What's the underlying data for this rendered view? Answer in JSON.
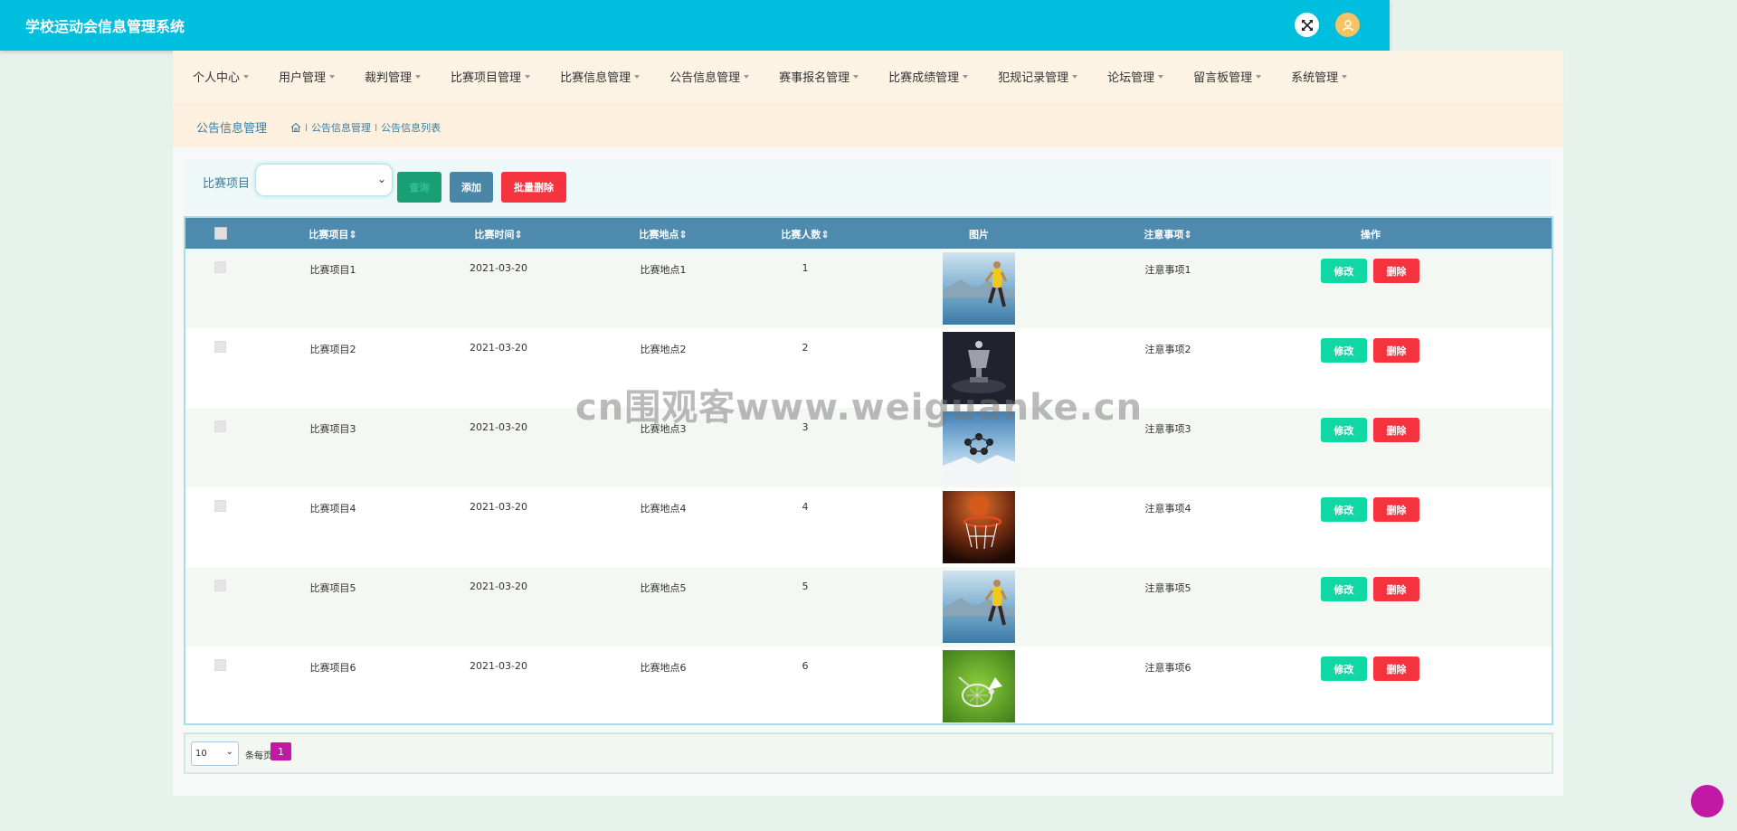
{
  "header": {
    "title": "学校运动会信息管理系统",
    "fullscreen_icon": "expand-icon",
    "user_icon": "user-avatar-icon"
  },
  "nav": {
    "items": [
      {
        "label": "个人中心"
      },
      {
        "label": "用户管理"
      },
      {
        "label": "裁判管理"
      },
      {
        "label": "比赛项目管理"
      },
      {
        "label": "比赛信息管理"
      },
      {
        "label": "公告信息管理"
      },
      {
        "label": "赛事报名管理"
      },
      {
        "label": "比赛成绩管理"
      },
      {
        "label": "犯规记录管理"
      },
      {
        "label": "论坛管理"
      },
      {
        "label": "留言板管理"
      },
      {
        "label": "系统管理"
      }
    ]
  },
  "breadcrumb": {
    "title": "公告信息管理",
    "home_icon": "home-icon",
    "sep": "l",
    "level1": "公告信息管理",
    "level2": "公告信息列表"
  },
  "filter": {
    "label": "比赛项目",
    "select_value": "",
    "search_label": "查询",
    "add_label": "添加",
    "batch_delete_label": "批量删除"
  },
  "table": {
    "columns": [
      "比赛项目",
      "比赛时间",
      "比赛地点",
      "比赛人数",
      "图片",
      "注意事项",
      "操作"
    ],
    "sort_mark": "⇕",
    "rows": [
      {
        "name": "比赛项目1",
        "time": "2021-03-20",
        "place": "比赛地点1",
        "count": "1",
        "note": "注意事项1",
        "image": "runner-photo"
      },
      {
        "name": "比赛项目2",
        "time": "2021-03-20",
        "place": "比赛地点2",
        "count": "2",
        "note": "注意事项2",
        "image": "trophy-photo"
      },
      {
        "name": "比赛项目3",
        "time": "2021-03-20",
        "place": "比赛地点3",
        "count": "3",
        "note": "注意事项3",
        "image": "skydivers-photo"
      },
      {
        "name": "比赛项目4",
        "time": "2021-03-20",
        "place": "比赛地点4",
        "count": "4",
        "note": "注意事项4",
        "image": "basketball-hoop-photo"
      },
      {
        "name": "比赛项目5",
        "time": "2021-03-20",
        "place": "比赛地点5",
        "count": "5",
        "note": "注意事项5",
        "image": "runner-photo"
      },
      {
        "name": "比赛项目6",
        "time": "2021-03-20",
        "place": "比赛地点6",
        "count": "6",
        "note": "注意事项6",
        "image": "badminton-photo"
      }
    ],
    "edit_label": "修改",
    "delete_label": "删除"
  },
  "pager": {
    "page_size": "10",
    "per_page_text": "条每页",
    "current_page": "1"
  },
  "watermark": "cn围观客www.weiguanke.cn",
  "colors": {
    "header": "#00bedd",
    "nav_bg": "#fdf3e4",
    "table_header": "#4d8aae",
    "edit": "#11d7a5",
    "delete": "#f5333f",
    "accent": "#c218a3"
  }
}
